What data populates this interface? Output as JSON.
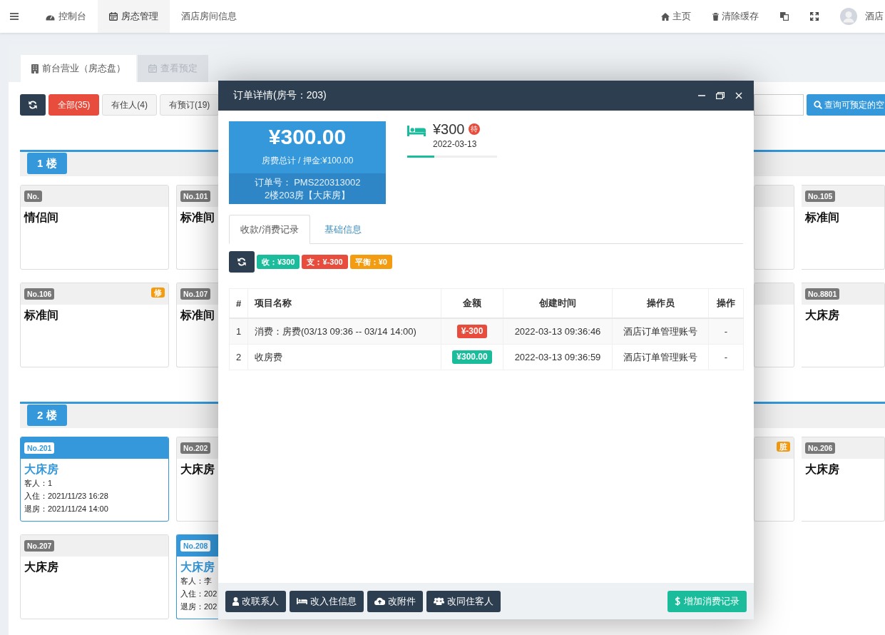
{
  "topbar": {
    "nav": [
      {
        "label": "控制台",
        "selected": false
      },
      {
        "label": "房态管理",
        "selected": true
      },
      {
        "label": "酒店房间信息",
        "selected": false
      }
    ],
    "actions": [
      "主页",
      "清除缓存"
    ],
    "user": {
      "name": "酒店"
    }
  },
  "page_tabs": [
    {
      "label": "前台营业（房态盘）",
      "selected": true
    },
    {
      "label": "查看预定",
      "selected": false
    }
  ],
  "toolbar": {
    "filters": [
      {
        "label": "全部(35)",
        "selected": true
      },
      {
        "label": "有住人(4)",
        "selected": false
      },
      {
        "label": "有预订(19)",
        "selected": false
      }
    ],
    "search_button": "查询可预定的空"
  },
  "floors": [
    {
      "label": "1 楼",
      "rows": [
        [
          {
            "number": "No.",
            "title": "情侣间",
            "occupied": false
          },
          {
            "number": "No.101",
            "title": "标准间",
            "occupied": false
          },
          {
            "occupied": false
          },
          {
            "number": "No.105",
            "title": "标准间",
            "occupied": false
          }
        ],
        [
          {
            "number": "No.106",
            "title": "标准间",
            "occupied": false,
            "tag": "修"
          },
          {
            "number": "No.107",
            "title": "标准间",
            "occupied": false
          },
          {
            "occupied": false
          },
          {
            "number": "No.8801",
            "title": "大床房",
            "occupied": false
          }
        ]
      ]
    },
    {
      "label": "2 楼",
      "rows": [
        [
          {
            "number": "No.201",
            "title": "大床房",
            "occupied": true,
            "guest_lines": [
              "客人：1",
              "入住：2021/11/23 16:28",
              "退房：2021/11/24 14:00"
            ]
          },
          {
            "number": "No.202",
            "title": "大床房",
            "occupied": false
          },
          {
            "occupied": false,
            "tag": "脏"
          },
          {
            "number": "No.206",
            "title": "大床房",
            "occupied": false
          }
        ],
        [
          {
            "number": "No.207",
            "title": "大床房",
            "occupied": false
          },
          {
            "number": "No.208",
            "title": "大床房",
            "occupied": true,
            "guest_lines": [
              "客人：李",
              "入住：202",
              "退房：202"
            ]
          }
        ]
      ]
    }
  ],
  "modal": {
    "title": "订单详情(房号：203)",
    "summary": {
      "total": "¥300.00",
      "caption": "房费总计 / 押金:¥100.00",
      "order_no": "订单号： PMS220313002",
      "room": "2楼203房【大床房】"
    },
    "rate": {
      "price": "¥300",
      "badge": "待",
      "date": "2022-03-13",
      "level": 0.3
    },
    "tabs": [
      {
        "label": "收款/消费记录",
        "selected": true
      },
      {
        "label": "基础信息",
        "selected": false
      }
    ],
    "balance": [
      {
        "text": "收：¥300",
        "color": "#1abc9c"
      },
      {
        "text": "支：¥-300",
        "color": "#e74c3c"
      },
      {
        "text": "平衡：¥0",
        "color": "#f39c12"
      }
    ],
    "table": {
      "columns": [
        "#",
        "项目名称",
        "金额",
        "创建时间",
        "操作员",
        "操作"
      ],
      "rows": [
        {
          "index": "1",
          "item": "消费：房费(03/13 09:36 -- 03/14 14:00)",
          "amount": "¥-300",
          "color": "#e74c3c",
          "created": "2022-03-13 09:36:46",
          "operator": "酒店订单管理账号",
          "action": "-"
        },
        {
          "index": "2",
          "item": "收房费",
          "amount": "¥300.00",
          "color": "#1abc9c",
          "created": "2022-03-13 09:36:59",
          "operator": "酒店订单管理账号",
          "action": "-"
        }
      ]
    },
    "footer_buttons": [
      "改联系人",
      "改入住信息",
      "改附件",
      "改同住客人"
    ],
    "add_button": "增加消费记录"
  }
}
